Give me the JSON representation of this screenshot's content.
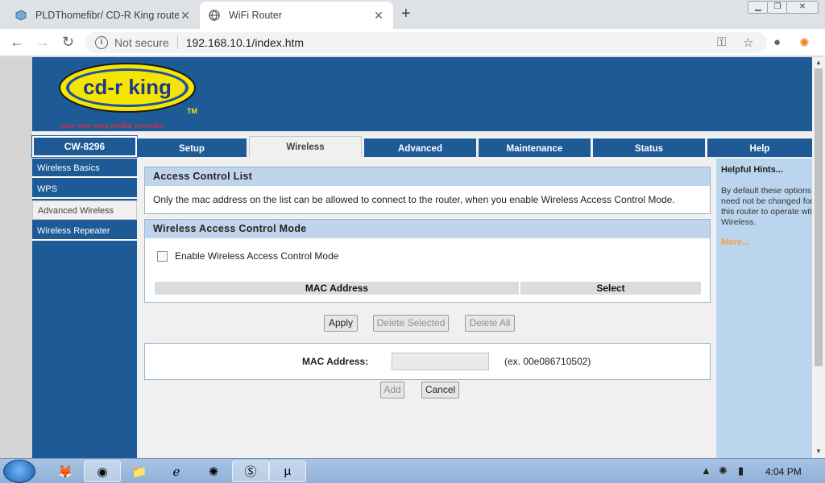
{
  "browser": {
    "tabs": [
      {
        "title": "PLDThomefibr/ CD-R King router",
        "active": false
      },
      {
        "title": "WiFi Router",
        "active": true
      }
    ],
    "security_label": "Not secure",
    "url": "192.168.10.1/index.htm",
    "accent": "#dee1e6"
  },
  "router": {
    "logo_text": "cd-r king",
    "logo_tm": "TM",
    "logo_tagline": "your one-stop media provider",
    "model": "CW-8296",
    "brand_color": "#1e5a96",
    "tabs": [
      "Setup",
      "Wireless",
      "Advanced",
      "Maintenance",
      "Status",
      "Help"
    ],
    "selected_tab": "Wireless",
    "menu": [
      "Wireless Basics",
      "WPS",
      "Advanced Wireless",
      "Wireless Repeater"
    ],
    "selected_menu": "Advanced Wireless"
  },
  "acl": {
    "title": "Access Control List",
    "description": "Only the mac address on the list can be allowed to connect to the router, when you enable Wireless Access Control Mode."
  },
  "mode": {
    "title": "Wireless Access Control Mode",
    "checkbox_label": "Enable Wireless Access Control Mode",
    "checked": false,
    "columns": [
      "MAC Address",
      "Select"
    ]
  },
  "buttons": {
    "apply": "Apply",
    "delete_selected": "Delete Selected",
    "delete_all": "Delete All",
    "add": "Add",
    "cancel": "Cancel"
  },
  "mac_form": {
    "label": "MAC Address:",
    "value": "",
    "example": "(ex. 00e086710502)"
  },
  "help": {
    "title": "Helpful Hints...",
    "text": "By default these options need not be changed for this router to operate with Wireless.",
    "more": "More..."
  },
  "taskbar": {
    "clock": "4:04 PM"
  }
}
